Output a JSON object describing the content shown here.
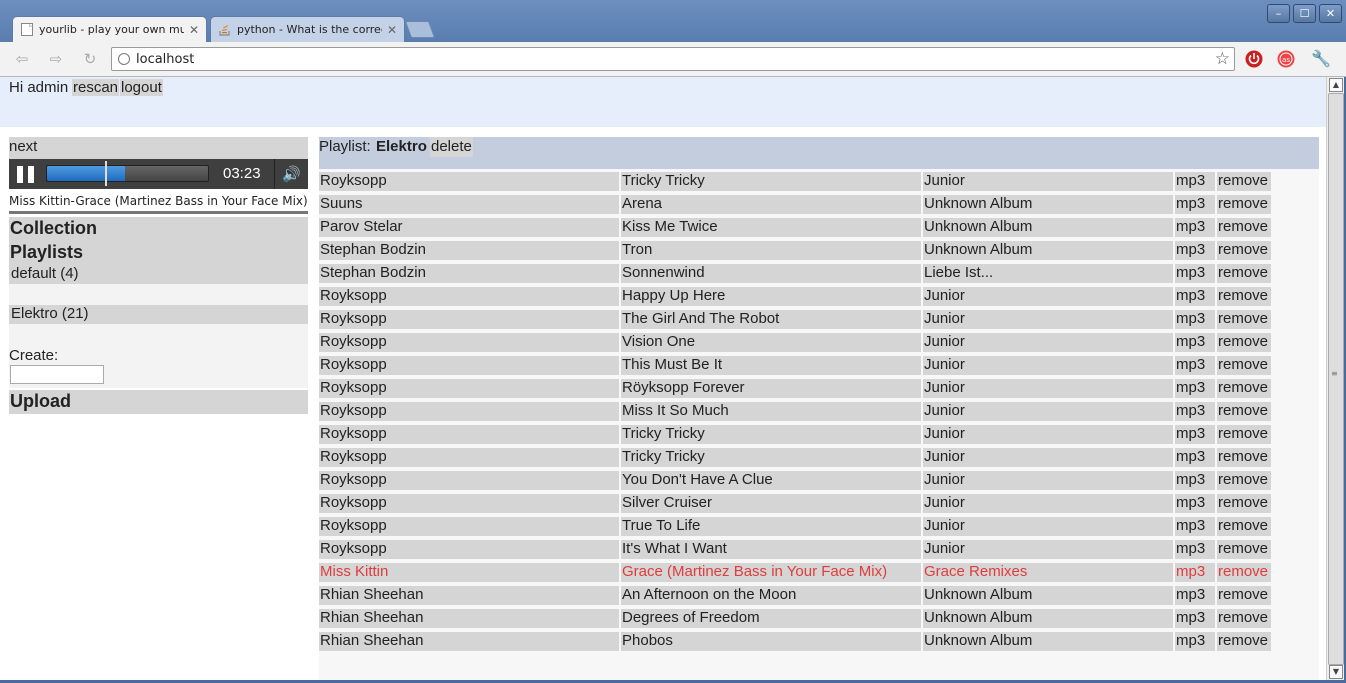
{
  "browser": {
    "tabs": [
      {
        "title": "yourlib - play your own mu",
        "active": true
      },
      {
        "title": "python - What is the correc",
        "active": false
      }
    ],
    "address": "localhost"
  },
  "header": {
    "greeting": "Hi admin",
    "rescan_label": "rescan",
    "logout_label": "logout"
  },
  "player": {
    "next_label": "next",
    "time": "03:23",
    "progress": 0.47,
    "now_playing": "Miss Kittin-Grace (Martinez Bass in Your Face Mix)"
  },
  "sidebar": {
    "collection_label": "Collection",
    "playlists_label": "Playlists",
    "playlists": [
      {
        "label": "default (4)"
      },
      {
        "label": "Elektro (21)"
      }
    ],
    "create_label": "Create:",
    "upload_label": "Upload"
  },
  "playlist": {
    "prefix": "Playlist:",
    "name": "Elektro",
    "delete_label": "delete",
    "remove_label": "remove",
    "tracks": [
      {
        "artist": "Royksopp",
        "title": "Tricky Tricky",
        "album": "Junior",
        "format": "mp3"
      },
      {
        "artist": "Suuns",
        "title": "Arena",
        "album": "Unknown Album",
        "format": "mp3"
      },
      {
        "artist": "Parov Stelar",
        "title": "Kiss Me Twice",
        "album": "Unknown Album",
        "format": "mp3"
      },
      {
        "artist": "Stephan Bodzin",
        "title": "Tron",
        "album": "Unknown Album",
        "format": "mp3"
      },
      {
        "artist": "Stephan Bodzin",
        "title": "Sonnenwind",
        "album": "Liebe Ist...",
        "format": "mp3"
      },
      {
        "artist": "Royksopp",
        "title": "Happy Up Here",
        "album": "Junior",
        "format": "mp3"
      },
      {
        "artist": "Royksopp",
        "title": "The Girl And The Robot",
        "album": "Junior",
        "format": "mp3"
      },
      {
        "artist": "Royksopp",
        "title": "Vision One",
        "album": "Junior",
        "format": "mp3"
      },
      {
        "artist": "Royksopp",
        "title": "This Must Be It",
        "album": "Junior",
        "format": "mp3"
      },
      {
        "artist": "Royksopp",
        "title": "Röyksopp Forever",
        "album": "Junior",
        "format": "mp3"
      },
      {
        "artist": "Royksopp",
        "title": "Miss It So Much",
        "album": "Junior",
        "format": "mp3"
      },
      {
        "artist": "Royksopp",
        "title": "Tricky Tricky",
        "album": "Junior",
        "format": "mp3"
      },
      {
        "artist": "Royksopp",
        "title": "Tricky Tricky",
        "album": "Junior",
        "format": "mp3"
      },
      {
        "artist": "Royksopp",
        "title": "You Don't Have A Clue",
        "album": "Junior",
        "format": "mp3"
      },
      {
        "artist": "Royksopp",
        "title": "Silver Cruiser",
        "album": "Junior",
        "format": "mp3"
      },
      {
        "artist": "Royksopp",
        "title": "True To Life",
        "album": "Junior",
        "format": "mp3"
      },
      {
        "artist": "Royksopp",
        "title": "It's What I Want",
        "album": "Junior",
        "format": "mp3"
      },
      {
        "artist": "Miss Kittin",
        "title": "Grace (Martinez Bass in Your Face Mix)",
        "album": "Grace Remixes",
        "format": "mp3",
        "playing": true
      },
      {
        "artist": "Rhian Sheehan",
        "title": "An Afternoon on the Moon",
        "album": "Unknown Album",
        "format": "mp3"
      },
      {
        "artist": "Rhian Sheehan",
        "title": "Degrees of Freedom",
        "album": "Unknown Album",
        "format": "mp3"
      },
      {
        "artist": "Rhian Sheehan",
        "title": "Phobos",
        "album": "Unknown Album",
        "format": "mp3"
      }
    ]
  },
  "colors": {
    "playing_text": "#e03c3c",
    "header_bg": "#e6edfb",
    "playlist_header_bg": "#c4cdde",
    "progress_fill": "#1f6bc0"
  }
}
